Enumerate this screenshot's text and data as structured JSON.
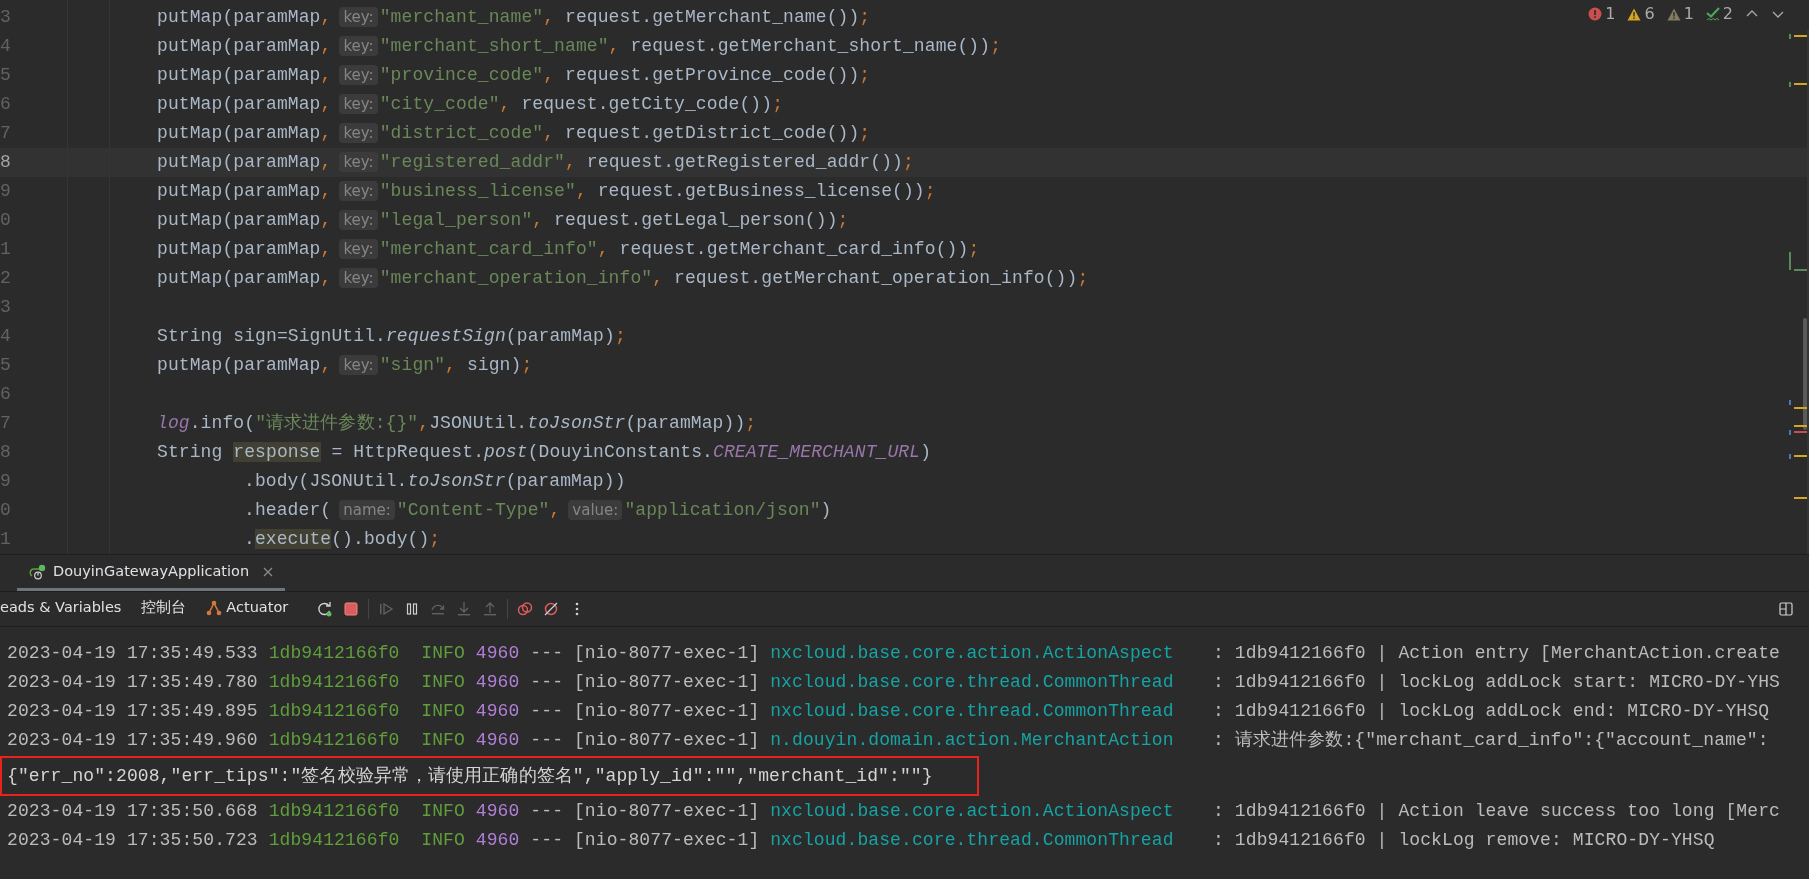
{
  "editor": {
    "inspections": [
      {
        "kind": "error",
        "count": "1"
      },
      {
        "kind": "warning",
        "count": "6"
      },
      {
        "kind": "weak",
        "count": "1"
      },
      {
        "kind": "typo",
        "count": "2"
      }
    ],
    "lines": [
      {
        "number": "3",
        "kind": "code",
        "current": false,
        "tokens": [
          {
            "kind": "text",
            "text": "putMap(paramMap"
          },
          {
            "kind": "punct",
            "text": ","
          },
          {
            "kind": "hint",
            "text": "key:"
          },
          {
            "kind": "string",
            "text": "\"merchant_name\""
          },
          {
            "kind": "punct",
            "text": ","
          },
          {
            "kind": "text",
            "text": " request.getMerchant_name())"
          },
          {
            "kind": "punct",
            "text": ";"
          }
        ]
      },
      {
        "number": "4",
        "kind": "code",
        "current": false,
        "tokens": [
          {
            "kind": "text",
            "text": "putMap(paramMap"
          },
          {
            "kind": "punct",
            "text": ","
          },
          {
            "kind": "hint",
            "text": "key:"
          },
          {
            "kind": "string",
            "text": "\"merchant_short_name\""
          },
          {
            "kind": "punct",
            "text": ","
          },
          {
            "kind": "text",
            "text": " request.getMerchant_short_name())"
          },
          {
            "kind": "punct",
            "text": ";"
          }
        ]
      },
      {
        "number": "5",
        "kind": "code",
        "current": false,
        "tokens": [
          {
            "kind": "text",
            "text": "putMap(paramMap"
          },
          {
            "kind": "punct",
            "text": ","
          },
          {
            "kind": "hint",
            "text": "key:"
          },
          {
            "kind": "string",
            "text": "\"province_code\""
          },
          {
            "kind": "punct",
            "text": ","
          },
          {
            "kind": "text",
            "text": " request.getProvince_code())"
          },
          {
            "kind": "punct",
            "text": ";"
          }
        ]
      },
      {
        "number": "6",
        "kind": "code",
        "current": false,
        "tokens": [
          {
            "kind": "text",
            "text": "putMap(paramMap"
          },
          {
            "kind": "punct",
            "text": ","
          },
          {
            "kind": "hint",
            "text": "key:"
          },
          {
            "kind": "string",
            "text": "\"city_code\""
          },
          {
            "kind": "punct",
            "text": ","
          },
          {
            "kind": "text",
            "text": " request.getCity_code())"
          },
          {
            "kind": "punct",
            "text": ";"
          }
        ]
      },
      {
        "number": "7",
        "kind": "code",
        "current": false,
        "tokens": [
          {
            "kind": "text",
            "text": "putMap(paramMap"
          },
          {
            "kind": "punct",
            "text": ","
          },
          {
            "kind": "hint",
            "text": "key:"
          },
          {
            "kind": "string",
            "text": "\"district_code\""
          },
          {
            "kind": "punct",
            "text": ","
          },
          {
            "kind": "text",
            "text": " request.getDistrict_code())"
          },
          {
            "kind": "punct",
            "text": ";"
          }
        ]
      },
      {
        "number": "8",
        "kind": "code",
        "current": true,
        "tokens": [
          {
            "kind": "text",
            "text": "putMap(paramMap"
          },
          {
            "kind": "punct",
            "text": ","
          },
          {
            "kind": "hint",
            "text": "key:"
          },
          {
            "kind": "string",
            "text": "\"registered_addr\""
          },
          {
            "kind": "punct",
            "text": ","
          },
          {
            "kind": "text",
            "text": " request.getRegistered_addr())"
          },
          {
            "kind": "punct",
            "text": ";"
          }
        ]
      },
      {
        "number": "9",
        "kind": "code",
        "current": false,
        "tokens": [
          {
            "kind": "text",
            "text": "putMap(paramMap"
          },
          {
            "kind": "punct",
            "text": ","
          },
          {
            "kind": "hint",
            "text": "key:"
          },
          {
            "kind": "string",
            "text": "\"business_license\""
          },
          {
            "kind": "punct",
            "text": ","
          },
          {
            "kind": "text",
            "text": " request.getBusiness_license())"
          },
          {
            "kind": "punct",
            "text": ";"
          }
        ]
      },
      {
        "number": "0",
        "kind": "code",
        "current": false,
        "tokens": [
          {
            "kind": "text",
            "text": "putMap(paramMap"
          },
          {
            "kind": "punct",
            "text": ","
          },
          {
            "kind": "hint",
            "text": "key:"
          },
          {
            "kind": "string",
            "text": "\"legal_person\""
          },
          {
            "kind": "punct",
            "text": ","
          },
          {
            "kind": "text",
            "text": " request.getLegal_person())"
          },
          {
            "kind": "punct",
            "text": ";"
          }
        ]
      },
      {
        "number": "1",
        "kind": "code",
        "current": false,
        "tokens": [
          {
            "kind": "text",
            "text": "putMap(paramMap"
          },
          {
            "kind": "punct",
            "text": ","
          },
          {
            "kind": "hint",
            "text": "key:"
          },
          {
            "kind": "string",
            "text": "\"merchant_card_info\""
          },
          {
            "kind": "punct",
            "text": ","
          },
          {
            "kind": "text",
            "text": " request.getMerchant_card_info())"
          },
          {
            "kind": "punct",
            "text": ";"
          }
        ]
      },
      {
        "number": "2",
        "kind": "code",
        "current": false,
        "tokens": [
          {
            "kind": "text",
            "text": "putMap(paramMap"
          },
          {
            "kind": "punct",
            "text": ","
          },
          {
            "kind": "hint",
            "text": "key:"
          },
          {
            "kind": "string",
            "text": "\"merchant_operation_info\""
          },
          {
            "kind": "punct",
            "text": ","
          },
          {
            "kind": "text",
            "text": " request.getMerchant_operation_info())"
          },
          {
            "kind": "punct",
            "text": ";"
          }
        ]
      },
      {
        "number": "3",
        "current": false
      },
      {
        "number": "4",
        "kind": "code",
        "current": false,
        "tokens": [
          {
            "kind": "text",
            "text": "String sign=SignUtil."
          },
          {
            "kind": "italic",
            "text": "requestSign"
          },
          {
            "kind": "text",
            "text": "(paramMap)"
          },
          {
            "kind": "punct",
            "text": ";"
          }
        ]
      },
      {
        "number": "5",
        "kind": "code",
        "current": false,
        "tokens": [
          {
            "kind": "text",
            "text": "putMap(paramMap"
          },
          {
            "kind": "punct",
            "text": ","
          },
          {
            "kind": "hint",
            "text": "key:"
          },
          {
            "kind": "string",
            "text": "\"sign\""
          },
          {
            "kind": "punct",
            "text": ","
          },
          {
            "kind": "text",
            "text": " sign)"
          },
          {
            "kind": "punct",
            "text": ";"
          }
        ]
      },
      {
        "number": "6",
        "current": false
      },
      {
        "number": "7",
        "kind": "code",
        "current": false,
        "tokens": [
          {
            "kind": "field",
            "text": "log"
          },
          {
            "kind": "text",
            "text": ".info("
          },
          {
            "kind": "string",
            "text": "\"请求进件参数:{}\""
          },
          {
            "kind": "punct",
            "text": ","
          },
          {
            "kind": "text",
            "text": "JSONUtil."
          },
          {
            "kind": "italic",
            "text": "toJsonStr"
          },
          {
            "kind": "text",
            "text": "(paramMap))"
          },
          {
            "kind": "punct",
            "text": ";"
          }
        ]
      },
      {
        "number": "8",
        "kind": "code",
        "current": false,
        "tokens": [
          {
            "kind": "text",
            "text": "String "
          },
          {
            "kind": "occurrence",
            "text": "response"
          },
          {
            "kind": "text",
            "text": " = HttpRequest."
          },
          {
            "kind": "italic",
            "text": "post"
          },
          {
            "kind": "text",
            "text": "(DouyinConstants."
          },
          {
            "kind": "constant",
            "text": "CREATE_MERCHANT_URL"
          },
          {
            "kind": "text",
            "text": ")"
          }
        ]
      },
      {
        "number": "9",
        "kind": "continuation",
        "current": false,
        "tokens": [
          {
            "kind": "text",
            "text": ".body(JSONUtil."
          },
          {
            "kind": "italic",
            "text": "toJsonStr"
          },
          {
            "kind": "text",
            "text": "(paramMap))"
          }
        ]
      },
      {
        "number": "0",
        "kind": "continuation",
        "current": false,
        "tokens": [
          {
            "kind": "text",
            "text": ".header("
          },
          {
            "kind": "hint",
            "text": "name:"
          },
          {
            "kind": "string",
            "text": "\"Content-Type\""
          },
          {
            "kind": "punct",
            "text": ","
          },
          {
            "kind": "hint",
            "text": "value:"
          },
          {
            "kind": "string",
            "text": "\"application/json\""
          },
          {
            "kind": "text",
            "text": ")"
          }
        ]
      },
      {
        "number": "1",
        "kind": "continuation",
        "current": false,
        "tokens": [
          {
            "kind": "text",
            "text": "."
          },
          {
            "kind": "occurrence",
            "text": "execute"
          },
          {
            "kind": "text",
            "text": "().body()"
          },
          {
            "kind": "punct",
            "text": ";"
          }
        ]
      }
    ]
  },
  "run_panel": {
    "tabs": [
      {
        "label": "DouyinGatewayApplication",
        "selected": true
      }
    ],
    "views": [
      {
        "label": "eads & Variables",
        "kind": "plain",
        "selected": false
      },
      {
        "label": "控制台",
        "kind": "plain",
        "selected": false
      },
      {
        "label": "Actuator",
        "kind": "actuator",
        "selected": false
      }
    ],
    "buttons": [
      {
        "kind": "rerun",
        "disabled": false
      },
      {
        "kind": "stop",
        "disabled": false
      },
      {
        "kind": "resume",
        "disabled": true
      },
      {
        "kind": "pause",
        "disabled": false
      },
      {
        "kind": "step-over",
        "disabled": true
      },
      {
        "kind": "step-into",
        "disabled": true
      },
      {
        "kind": "step-out",
        "disabled": true
      },
      {
        "kind": "breakpoints",
        "disabled": false
      },
      {
        "kind": "mute",
        "disabled": false
      },
      {
        "kind": "more",
        "disabled": false
      }
    ],
    "console": [
      {
        "kind": "log",
        "time": "2023-04-19 17:35:49.533",
        "trace": "1db9412166f0",
        "level": "INFO",
        "pid": "4960",
        "separator": "---",
        "thread": "[nio-8077-exec-1]",
        "logger": "nxcloud.base.core.action.ActionAspect",
        "message": ": 1db9412166f0 | Action entry [MerchantAction.create"
      },
      {
        "kind": "log",
        "time": "2023-04-19 17:35:49.780",
        "trace": "1db9412166f0",
        "level": "INFO",
        "pid": "4960",
        "separator": "---",
        "thread": "[nio-8077-exec-1]",
        "logger": "nxcloud.base.core.thread.CommonThread",
        "message": ": 1db9412166f0 | lockLog addLock start: MICRO-DY-YHS"
      },
      {
        "kind": "log",
        "time": "2023-04-19 17:35:49.895",
        "trace": "1db9412166f0",
        "level": "INFO",
        "pid": "4960",
        "separator": "---",
        "thread": "[nio-8077-exec-1]",
        "logger": "nxcloud.base.core.thread.CommonThread",
        "message": ": 1db9412166f0 | lockLog addLock end: MICRO-DY-YHSQ"
      },
      {
        "kind": "log",
        "time": "2023-04-19 17:35:49.960",
        "trace": "1db9412166f0",
        "level": "INFO",
        "pid": "4960",
        "separator": "---",
        "thread": "[nio-8077-exec-1]",
        "logger": "n.douyin.domain.action.MerchantAction",
        "message": ": 请求进件参数:{\"merchant_card_info\":{\"account_name\":"
      },
      {
        "kind": "output",
        "text": "{\"err_no\":2008,\"err_tips\":\"签名校验异常，请使用正确的签名\",\"apply_id\":\"\",\"merchant_id\":\"\"}",
        "highlighted": true
      },
      {
        "kind": "log",
        "time": "2023-04-19 17:35:50.668",
        "trace": "1db9412166f0",
        "level": "INFO",
        "pid": "4960",
        "separator": "---",
        "thread": "[nio-8077-exec-1]",
        "logger": "nxcloud.base.core.action.ActionAspect",
        "message": ": 1db9412166f0 | Action leave success too long [Merc"
      },
      {
        "kind": "log",
        "time": "2023-04-19 17:35:50.723",
        "trace": "1db9412166f0",
        "level": "INFO",
        "pid": "4960",
        "separator": "---",
        "thread": "[nio-8077-exec-1]",
        "logger": "nxcloud.base.core.thread.CommonThread",
        "message": ": 1db9412166f0 | lockLog remove: MICRO-DY-YHSQ"
      }
    ]
  }
}
